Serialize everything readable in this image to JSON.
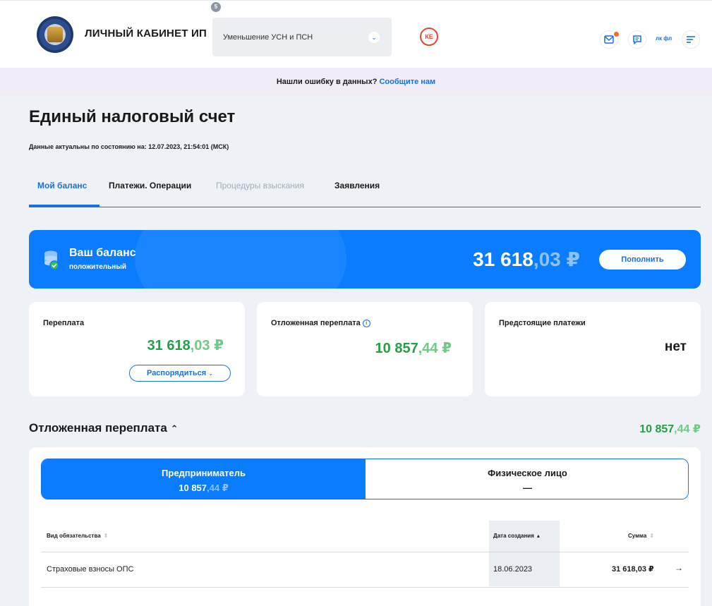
{
  "header": {
    "app_title": "ЛИЧНЫЙ КАБИНЕТ ИП",
    "select_value": "Уменьшение УСН и ПСН",
    "select_badge": "5",
    "ke_badge": "КЕ",
    "lk_label": "лк фл"
  },
  "banner": {
    "text": "Нашли ошибку в данных?",
    "link": "Сообщите нам"
  },
  "page": {
    "title": "Единый налоговый счет",
    "subtitle": "Данные актуальны по состоянию на: 12.07.2023, 21:54:01 (МСК)"
  },
  "tabs": [
    {
      "label": "Мой баланс"
    },
    {
      "label": "Платежи. Операции"
    },
    {
      "label": "Процедуры взыскания"
    },
    {
      "label": "Заявления"
    }
  ],
  "balance": {
    "title": "Ваш баланс",
    "status": "положительный",
    "amount_int": "31 618",
    "amount_frac": ",03 ₽",
    "topup_label": "Пополнить"
  },
  "cards": {
    "overpay": {
      "label": "Переплата",
      "amount_int": "31 618",
      "amount_frac": ",03 ₽",
      "action": "Распорядиться"
    },
    "deferred": {
      "label": "Отложенная переплата",
      "amount_int": "10 857",
      "amount_frac": ",44 ₽"
    },
    "upcoming": {
      "label": "Предстоящие платежи",
      "value": "нет"
    }
  },
  "deferred_section": {
    "title": "Отложенная переплата",
    "amount_int": "10 857",
    "amount_frac": ",44 ₽",
    "switch": {
      "left_name": "Предприниматель",
      "left_int": "10 857",
      "left_frac": ",44 ₽",
      "right_name": "Физическое лицо",
      "right_value": "—"
    },
    "table": {
      "headers": [
        "Вид обязательства",
        "Дата создания",
        "Сумма"
      ],
      "rows": [
        {
          "type": "Страховые взносы ОПС",
          "date": "18.06.2023",
          "sum": "31 618,03 ₽"
        }
      ]
    }
  }
}
